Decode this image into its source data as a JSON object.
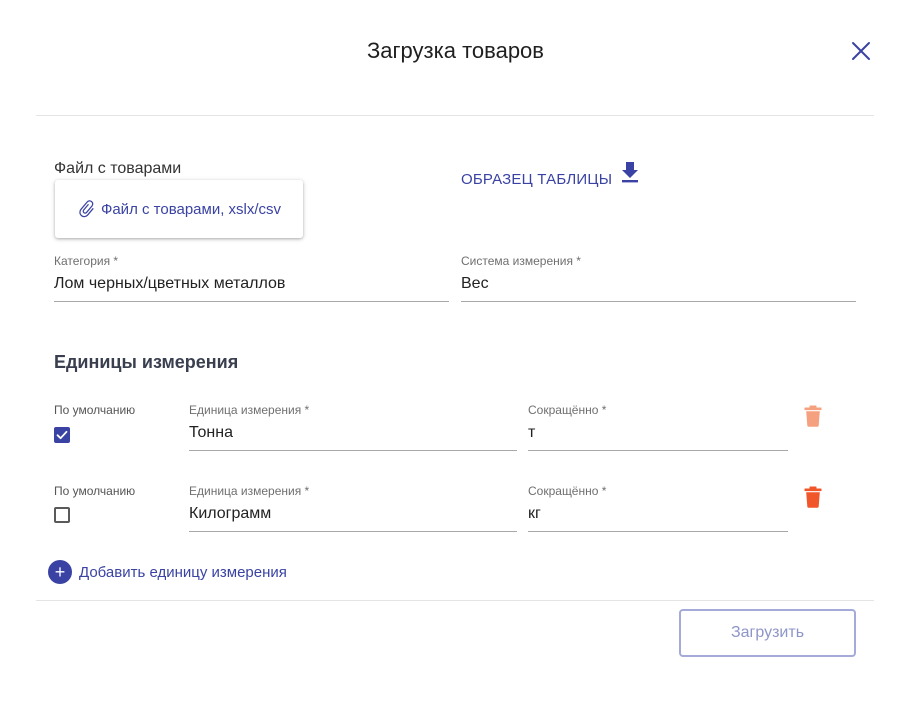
{
  "dialog": {
    "title": "Загрузка товаров"
  },
  "file": {
    "label": "Файл с товарами",
    "button_label": "Файл с товарами, xslx/csv"
  },
  "sample": {
    "label": "ОБРАЗЕЦ ТАБЛИЦЫ"
  },
  "category": {
    "label": "Категория *",
    "value": "Лом черных/цветных металлов"
  },
  "measure_system": {
    "label": "Система измерения *",
    "value": "Вес"
  },
  "units": {
    "title": "Единицы измерения",
    "rows": [
      {
        "default_label": "По умолчанию",
        "is_default": true,
        "unit_label": "Единица измерения *",
        "unit_value": "Тонна",
        "short_label": "Сокращённо *",
        "short_value": "т",
        "delete_color": "#f5a07e"
      },
      {
        "default_label": "По умолчанию",
        "is_default": false,
        "unit_label": "Единица измерения *",
        "unit_value": "Килограмм",
        "short_label": "Сокращённо *",
        "short_value": "кг",
        "delete_color": "#f0562a"
      }
    ],
    "add_label": "Добавить единицу измерения"
  },
  "footer": {
    "upload_label": "Загрузить"
  },
  "colors": {
    "accent": "#3a43a3",
    "upload_disabled": "#a4abd8"
  }
}
